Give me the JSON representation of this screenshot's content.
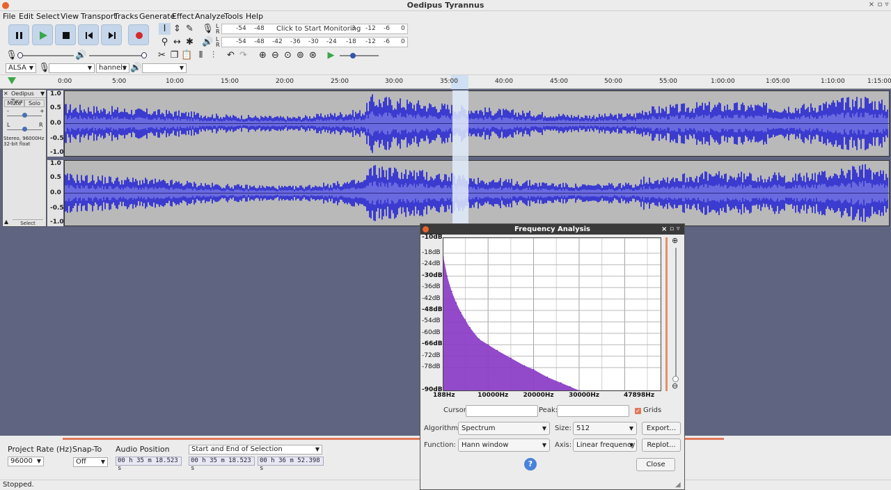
{
  "window": {
    "title": "Oedipus Tyrannus"
  },
  "menu": [
    "File",
    "Edit",
    "Select",
    "View",
    "Transport",
    "Tracks",
    "Generate",
    "Effect",
    "Analyze",
    "Tools",
    "Help"
  ],
  "meters": {
    "monitor_prompt": "Click to Start Monitoring",
    "record_ticks": [
      "-54",
      "-48",
      "3",
      "-12",
      "-6",
      "0"
    ],
    "play_ticks": [
      "-54",
      "-48",
      "-42",
      "-36",
      "-30",
      "-24",
      "-18",
      "-12",
      "-6",
      "0"
    ],
    "lr_top": [
      "L",
      "R"
    ],
    "lr_bottom": [
      "L",
      "R"
    ]
  },
  "device": {
    "host": "ALSA",
    "channels": "hannels"
  },
  "ruler": [
    "0:00",
    "5:00",
    "10:00",
    "15:00",
    "20:00",
    "25:00",
    "30:00",
    "35:00",
    "40:00",
    "45:00",
    "50:00",
    "55:00",
    "1:00:00",
    "1:05:00",
    "1:10:00",
    "1:15:00"
  ],
  "track": {
    "name": "Oedipus Tyra",
    "mute": "Mute",
    "solo": "Solo",
    "pan_l": "L",
    "pan_r": "R",
    "gain_minus": "-",
    "gain_plus": "+",
    "info1": "Stereo, 96000Hz",
    "info2": "32-bit float",
    "select": "Select",
    "scale": [
      "1.0",
      "0.5",
      "0.0",
      "-0.5",
      "-1.0"
    ]
  },
  "bottom": {
    "project_rate_label": "Project Rate (Hz)",
    "project_rate": "96000",
    "snap_label": "Snap-To",
    "snap_value": "Off",
    "audio_pos_label": "Audio Position",
    "audio_pos": "00 h 35 m 18.523 s",
    "selection_mode": "Start and End of Selection",
    "sel_start": "00 h 35 m 18.523 s",
    "sel_end": "00 h 36 m 52.398 s"
  },
  "status": "Stopped.",
  "dialog": {
    "title": "Frequency Analysis",
    "db_labels": [
      "-10dB",
      "-18dB",
      "-24dB",
      "-30dB",
      "-36dB",
      "-42dB",
      "-48dB",
      "-54dB",
      "-60dB",
      "-66dB",
      "-72dB",
      "-78dB",
      "-90dB"
    ],
    "hz_labels": [
      "188Hz",
      "10000Hz",
      "20000Hz",
      "30000Hz",
      "47898Hz"
    ],
    "cursor_label": "Cursor:",
    "peak_label": "Peak:",
    "grids_label": "Grids",
    "grids_checked": true,
    "algorithm_label": "Algorithm:",
    "algorithm": "Spectrum",
    "size_label": "Size:",
    "size": "512",
    "export_label": "Export...",
    "function_label": "Function:",
    "function": "Hann window",
    "axis_label": "Axis:",
    "axis": "Linear frequency",
    "replot_label": "Replot...",
    "help_label": "?",
    "close_label": "Close"
  },
  "chart_data": {
    "type": "area",
    "x": [
      188,
      1000,
      2000,
      3000,
      4000,
      5000,
      6000,
      8000,
      10000,
      12000,
      15000,
      18000,
      20000,
      23000,
      26000,
      28000,
      30000
    ],
    "values": [
      -20,
      -30,
      -38,
      -44,
      -49,
      -53,
      -57,
      -63,
      -66,
      -69,
      -73,
      -77,
      -79,
      -83,
      -86,
      -88,
      -90
    ],
    "xlabel": "",
    "ylabel": "",
    "ylim": [
      -90,
      -10
    ],
    "xlim": [
      188,
      47898
    ],
    "grid": true,
    "color": "#8a3bc6"
  },
  "colors": {
    "waveform": "#3b3bd0",
    "waveform_light": "#6a6ae0",
    "accent": "#e0785a"
  }
}
